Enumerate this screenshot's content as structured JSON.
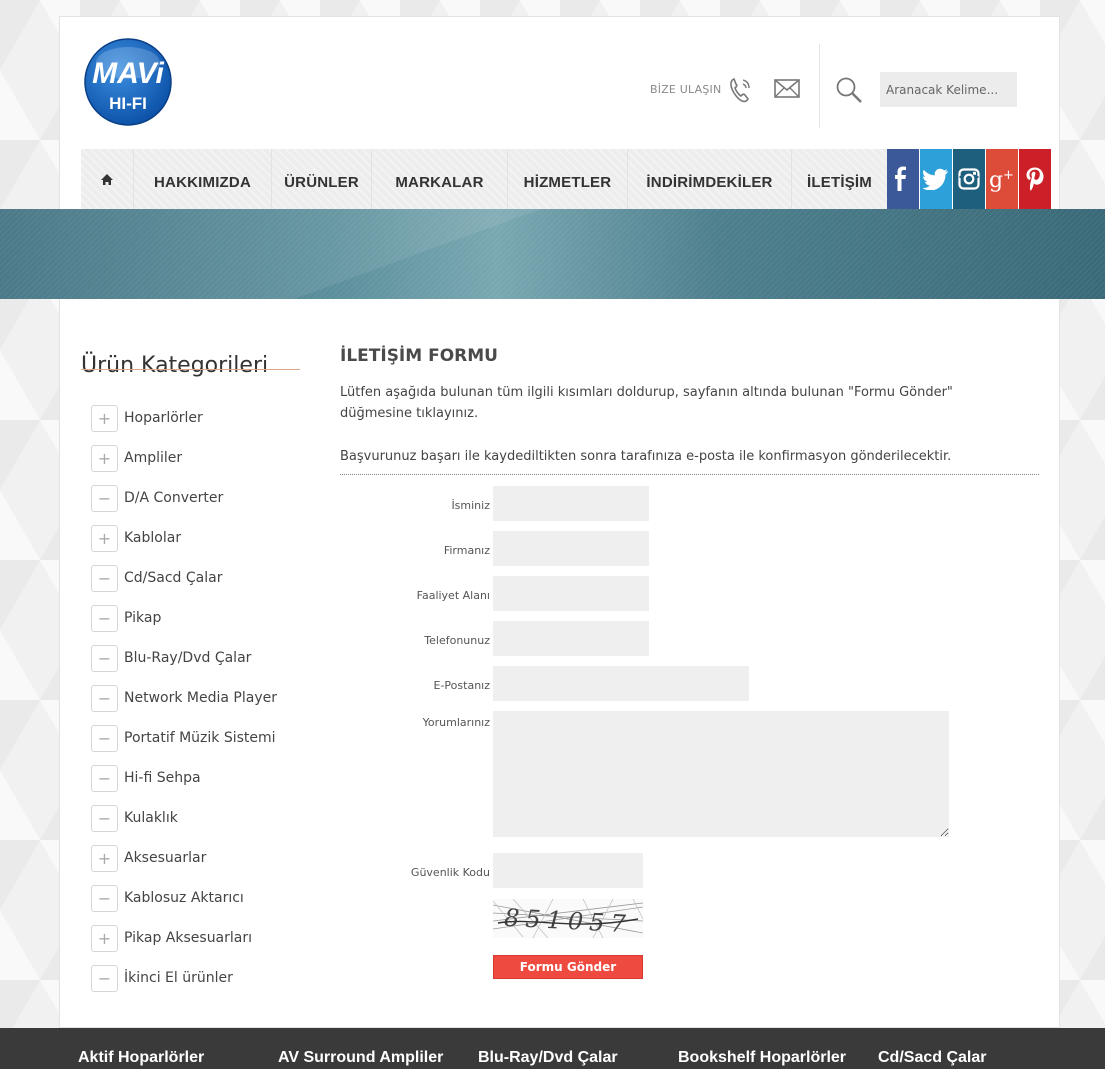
{
  "header": {
    "logo_top": "MAVi",
    "logo_bottom": "HI-FI",
    "contact_label": "BİZE ULAŞIN",
    "search_placeholder": "Aranacak Kelime..."
  },
  "nav": {
    "items": [
      "HAKKIMIZDA",
      "ÜRÜNLER",
      "MARKALAR",
      "HİZMETLER",
      "İNDİRİMDEKİLER",
      "İLETİŞİM"
    ]
  },
  "social": [
    {
      "name": "facebook-icon",
      "glyph": "f",
      "color": "#3b5998"
    },
    {
      "name": "twitter-icon",
      "glyph": "t",
      "color": "#2d9fd9"
    },
    {
      "name": "instagram-icon",
      "glyph": "ig",
      "color": "#1e5f7e"
    },
    {
      "name": "google-plus-icon",
      "glyph": "g+",
      "color": "#dd4b39"
    },
    {
      "name": "pinterest-icon",
      "glyph": "p",
      "color": "#cb2027"
    }
  ],
  "sidebar": {
    "title": "Ürün Kategorileri",
    "categories": [
      {
        "label": "Hoparlörler",
        "state": "+"
      },
      {
        "label": "Ampliler",
        "state": "+"
      },
      {
        "label": "D/A Converter",
        "state": "−"
      },
      {
        "label": "Kablolar",
        "state": "+"
      },
      {
        "label": "Cd/Sacd Çalar",
        "state": "−"
      },
      {
        "label": "Pikap",
        "state": "−"
      },
      {
        "label": "Blu-Ray/Dvd Çalar",
        "state": "−"
      },
      {
        "label": "Network Media Player",
        "state": "−"
      },
      {
        "label": "Portatif Müzik Sistemi",
        "state": "−"
      },
      {
        "label": "Hi-fi Sehpa",
        "state": "−"
      },
      {
        "label": "Kulaklık",
        "state": "−"
      },
      {
        "label": "Aksesuarlar",
        "state": "+"
      },
      {
        "label": "Kablosuz Aktarıcı",
        "state": "−"
      },
      {
        "label": "Pikap Aksesuarları",
        "state": "+"
      },
      {
        "label": "İkinci El ürünler",
        "state": "−"
      }
    ]
  },
  "form": {
    "title": "İLETİŞİM FORMU",
    "intro": "Lütfen aşağıda bulunan tüm ilgili kısımları doldurup, sayfanın altında bulunan \"Formu Gönder\" düğmesine tıklayınız.",
    "intro2": "Başvurunuz başarı ile kaydediltikten sonra tarafınıza e-posta ile konfirmasyon gönderilecektir.",
    "labels": {
      "name": "İsminiz",
      "company": "Firmanız",
      "activity": "Faaliyet Alanı",
      "phone": "Telefonunuz",
      "email": "E-Postanız",
      "comments": "Yorumlarınız",
      "security": "Güvenlik Kodu"
    },
    "captcha_text": "851057",
    "submit_label": "Formu Gönder"
  },
  "footer": {
    "links": [
      "Aktif Hoparlörler",
      "AV Surround Ampliler",
      "Blu-Ray/Dvd Çalar",
      "Bookshelf Hoparlörler",
      "Cd/Sacd Çalar"
    ]
  }
}
